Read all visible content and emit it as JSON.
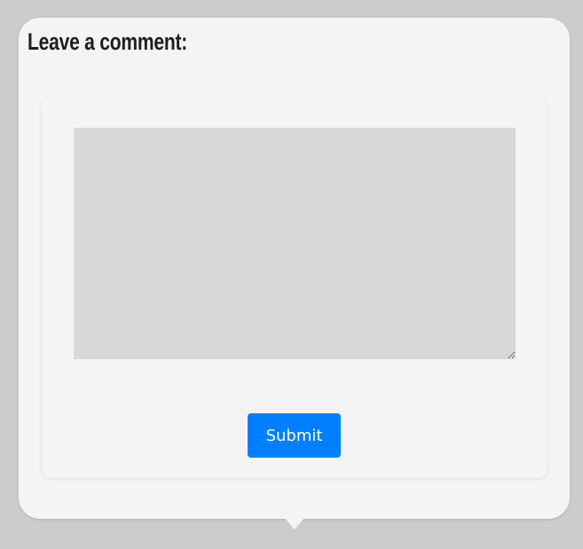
{
  "comment_form": {
    "title": "Leave a comment:",
    "textarea_value": "",
    "submit_label": "Submit"
  },
  "colors": {
    "page_background": "#cccccc",
    "card_background": "#f4f4f4",
    "textarea_background": "#d8d8d8",
    "button_background": "#0080ff",
    "button_text": "#ffffff",
    "title_text": "#1c1f22"
  }
}
